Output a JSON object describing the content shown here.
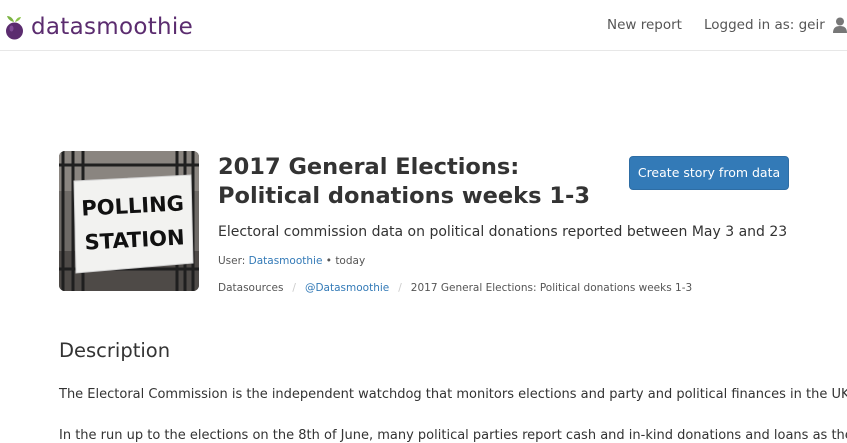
{
  "navbar": {
    "brand_name": "datasmoothie",
    "new_report_label": "New report",
    "logged_in_label": "Logged in as: geir"
  },
  "dataset": {
    "thumbnail_sign_line1": "POLLING",
    "thumbnail_sign_line2": "STATION",
    "title": "2017 General Elections: Political donations weeks 1-3",
    "subtitle": "Electoral commission data on political donations reported between May 3 and 23",
    "create_story_label": "Create story from data",
    "user_label": "User:",
    "user_name": "Datasmoothie",
    "separator_dot": "•",
    "date": "today"
  },
  "breadcrumb": {
    "items": [
      "Datasources",
      "@Datasmoothie",
      "2017 General Elections: Political donations weeks 1-3"
    ],
    "separator": "/"
  },
  "description": {
    "heading": "Description",
    "paragraph1": "The Electoral Commission is the independent watchdog that monitors elections and party and political finances in the UK.",
    "paragraph2": "In the run up to the elections on the 8th of June, many political parties report cash and in-kind donations and loans as they"
  },
  "colors": {
    "brand": "#5b2c6f",
    "primary_button": "#337ab7",
    "link": "#337ab7"
  }
}
